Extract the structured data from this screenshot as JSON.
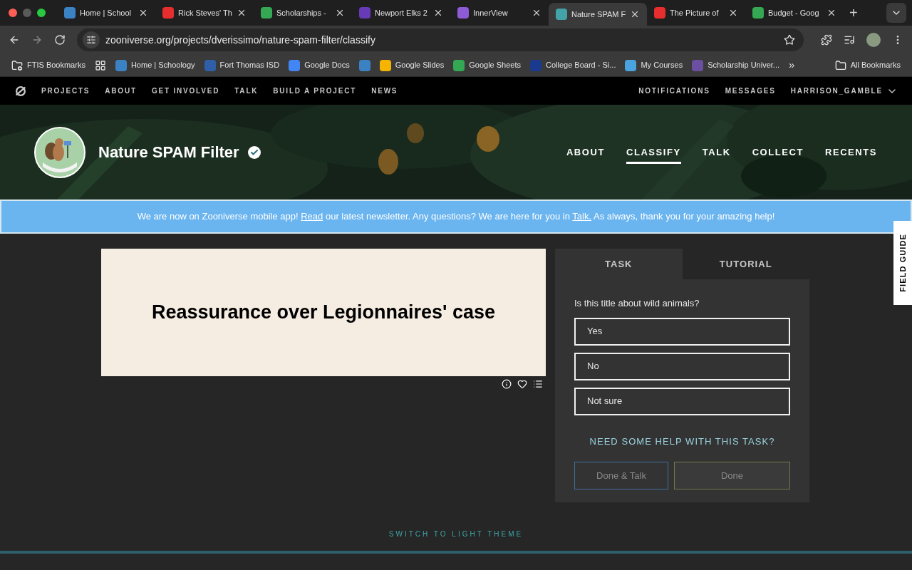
{
  "browser": {
    "tabs": [
      {
        "title": "Home | School",
        "selected": false,
        "color": "#3b82c4"
      },
      {
        "title": "Rick Steves' Th",
        "selected": false,
        "color": "#e62e2e"
      },
      {
        "title": "Scholarships -",
        "selected": false,
        "color": "#34a853"
      },
      {
        "title": "Newport Elks 2",
        "selected": false,
        "color": "#673ab7"
      },
      {
        "title": "InnerView",
        "selected": false,
        "color": "#8e5bd6"
      },
      {
        "title": "Nature SPAM F",
        "selected": true,
        "color": "#43a3a8"
      },
      {
        "title": "The Picture of",
        "selected": false,
        "color": "#e62e2e"
      },
      {
        "title": "Budget - Goog",
        "selected": false,
        "color": "#34a853"
      }
    ],
    "new_tab": "+",
    "url": "zooniverse.org/projects/dverissimo/nature-spam-filter/classify",
    "bookmarks": [
      {
        "label": "FTIS Bookmarks",
        "kind": "folder"
      },
      {
        "kind": "apps"
      },
      {
        "label": "Home | Schoology",
        "kind": "site",
        "color": "#3b82c4"
      },
      {
        "label": "Fort Thomas ISD",
        "kind": "site",
        "color": "#2f5fa8"
      },
      {
        "label": "Google Docs",
        "kind": "site",
        "color": "#4285f4"
      },
      {
        "kind": "site",
        "color": "#3b82c4"
      },
      {
        "label": "Google Slides",
        "kind": "site",
        "color": "#f4b400"
      },
      {
        "label": "Google Sheets",
        "kind": "site",
        "color": "#34a853"
      },
      {
        "label": "College Board - Si...",
        "kind": "site",
        "color": "#1a3a8f"
      },
      {
        "label": "My Courses",
        "kind": "site",
        "color": "#4aa3df"
      },
      {
        "label": "Scholarship Univer...",
        "kind": "site",
        "color": "#6b4fa0"
      }
    ],
    "more": "»",
    "all_bookmarks": "All Bookmarks"
  },
  "site_nav": {
    "left": [
      "PROJECTS",
      "ABOUT",
      "GET INVOLVED",
      "TALK",
      "BUILD A PROJECT",
      "NEWS"
    ],
    "right": [
      "NOTIFICATIONS",
      "MESSAGES",
      "HARRISON_GAMBLE"
    ]
  },
  "project": {
    "title": "Nature SPAM Filter",
    "verified": true,
    "nav": [
      {
        "label": "ABOUT",
        "selected": false
      },
      {
        "label": "CLASSIFY",
        "selected": true
      },
      {
        "label": "TALK",
        "selected": false
      },
      {
        "label": "COLLECT",
        "selected": false
      },
      {
        "label": "RECENTS",
        "selected": false
      }
    ]
  },
  "banner": [
    {
      "kind": "text",
      "text": "We are now on Zooniverse mobile app!"
    },
    {
      "kind": "link",
      "text": "Read"
    },
    {
      "kind": "text",
      "text": "our latest newsletter. Any questions? We are here for you in"
    },
    {
      "kind": "link",
      "text": "Talk."
    },
    {
      "kind": "text",
      "text": "As always, thank you for your amazing help!"
    }
  ],
  "subject": {
    "headline": "Reassurance over Legionnaires' case"
  },
  "task_panel": {
    "tabs": [
      {
        "label": "TASK",
        "selected": true
      },
      {
        "label": "TUTORIAL",
        "selected": false
      }
    ],
    "question": "Is this title about wild animals?",
    "answers": [
      {
        "label": "Yes",
        "selected": false
      },
      {
        "label": "No",
        "selected": false
      },
      {
        "label": "Not sure",
        "selected": false
      }
    ],
    "help": "NEED SOME HELP WITH THIS TASK?",
    "buttons": [
      {
        "label": "Done & Talk",
        "disabled": true,
        "color": "#3f6f9a"
      },
      {
        "label": "Done",
        "disabled": true,
        "color": "#6f7a4a"
      }
    ]
  },
  "field_guide": "FIELD GUIDE",
  "theme_toggle": "SWITCH TO LIGHT THEME"
}
